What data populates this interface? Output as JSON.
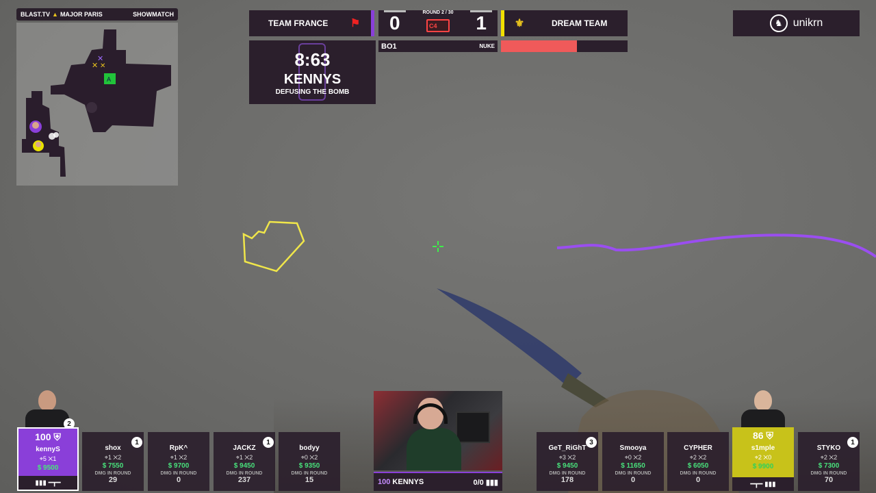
{
  "minimap": {
    "event": "BLAST.TV",
    "event_tail": "MAJOR PARIS",
    "badge": "SHOWMATCH"
  },
  "scoreboard": {
    "left_team": "TEAM FRANCE",
    "right_team": "DREAM TEAM",
    "left_score": "0",
    "right_score": "1",
    "round": "ROUND 2 / 30",
    "series": "BO1",
    "map": "NUKE",
    "bomb_icon_label": "C4",
    "right_team_hp_fraction": 0.6,
    "left_color": "#8a3fd9",
    "right_color": "#f1e000"
  },
  "bomb": {
    "time": "8:63",
    "player": "KENNYS",
    "action": "DEFUSING THE BOMB"
  },
  "sponsor": {
    "name": "unikrn",
    "icon": "unikrn-logo-icon"
  },
  "featured_left": {
    "hp": "100",
    "name": "kennyS",
    "kills": "5",
    "deaths": "1",
    "money": "$ 9500",
    "round_kills": "2",
    "weapons": "rifle-icon"
  },
  "featured_right": {
    "hp": "86",
    "name": "s1mple",
    "kills": "2",
    "deaths": "0",
    "money": "$ 9900",
    "weapons": "rifle-icon"
  },
  "dmg_label": "DMG IN ROUND",
  "left_players": [
    {
      "name": "shox",
      "kills": "1",
      "deaths": "2",
      "money": "$ 7550",
      "dmg": "29",
      "round_kills": "1"
    },
    {
      "name": "RpK^",
      "kills": "1",
      "deaths": "2",
      "money": "$ 9700",
      "dmg": "0",
      "round_kills": ""
    },
    {
      "name": "JACKZ",
      "kills": "1",
      "deaths": "2",
      "money": "$ 9450",
      "dmg": "237",
      "round_kills": "1"
    },
    {
      "name": "bodyy",
      "kills": "0",
      "deaths": "2",
      "money": "$ 9350",
      "dmg": "15",
      "round_kills": ""
    }
  ],
  "right_players": [
    {
      "name": "GeT_RiGhT",
      "kills": "3",
      "deaths": "2",
      "money": "$ 9450",
      "dmg": "178",
      "round_kills": "3"
    },
    {
      "name": "Smooya",
      "kills": "0",
      "deaths": "2",
      "money": "$ 11650",
      "dmg": "0",
      "round_kills": ""
    },
    {
      "name": "CYPHER",
      "kills": "2",
      "deaths": "2",
      "money": "$ 6050",
      "dmg": "0",
      "round_kills": ""
    },
    {
      "name": "STYKO",
      "kills": "2",
      "deaths": "2",
      "money": "$ 7300",
      "dmg": "70",
      "round_kills": "1"
    }
  ],
  "webcam": {
    "hp": "100",
    "player": "KENNYS",
    "ammo": "0/0"
  }
}
